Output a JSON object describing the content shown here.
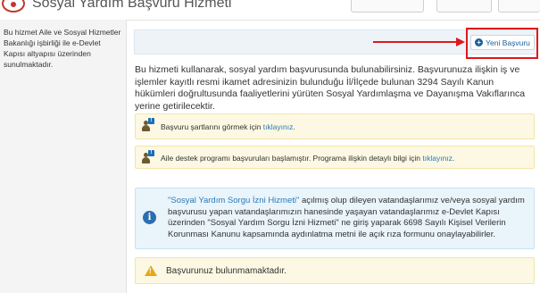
{
  "header": {
    "title": "Sosyal Yardım Başvuru Hizmeti",
    "buttons": [
      "",
      "",
      ""
    ]
  },
  "sidebar": {
    "text": "Bu hizmet Aile ve Sosyal Hizmetler Bakanlığı işbirliği ile e-Devlet Kapısı altyapısı üzerinden sunulmaktadır."
  },
  "toolbar": {
    "new_application_label": "Yeni Başvuru",
    "new_application_icon": "plus-circle-icon"
  },
  "intro": {
    "text": "Bu hizmeti kullanarak, sosyal yardım başvurusunda bulunabilirsiniz. Başvurunuza ilişkin iş ve işlemler kayıtlı resmi ikamet adresinizin bulunduğu İl/İlçede bulunan 3294 Sayılı Kanun hükümleri doğrultusunda faaliyetlerini yürüten Sosyal Yardımlaşma ve Dayanışma Vakıflarınca yerine getirilecektir."
  },
  "alerts": {
    "conditions": {
      "text": "Başvuru şartlarını görmek için ",
      "link": "tıklayınız",
      "suffix": "."
    },
    "family_support": {
      "text": "Aile destek programı başvuruları başlamıştır. Programa ilişkin detaylı bilgi için ",
      "link": "tıklayınız",
      "suffix": "."
    },
    "consent_info": {
      "link": "\"Sosyal Yardım Sorgu İzni Hizmeti\"",
      "text": " açılmış olup dileyen vatandaşlarımız ve/veya sosyal yardım başvurusu yapan vatandaşlarımızın hanesinde yaşayan vatandaşlarımız e-Devlet Kapısı üzerinden \"Sosyal Yardım Sorgu İzni Hizmeti\" ne giriş yaparak 6698 Sayılı Kişisel Verilerin Korunması Kanunu kapsamında aydınlatma metni ile açık rıza formunu onaylayabilirler."
    },
    "no_application": {
      "text": "Başvurunuz bulunmamaktadır."
    }
  },
  "colors": {
    "highlight": "#e0161b",
    "link": "#2a7ab8",
    "warning_bg": "#fcf8e3",
    "info_bg": "#eaf4fb"
  }
}
